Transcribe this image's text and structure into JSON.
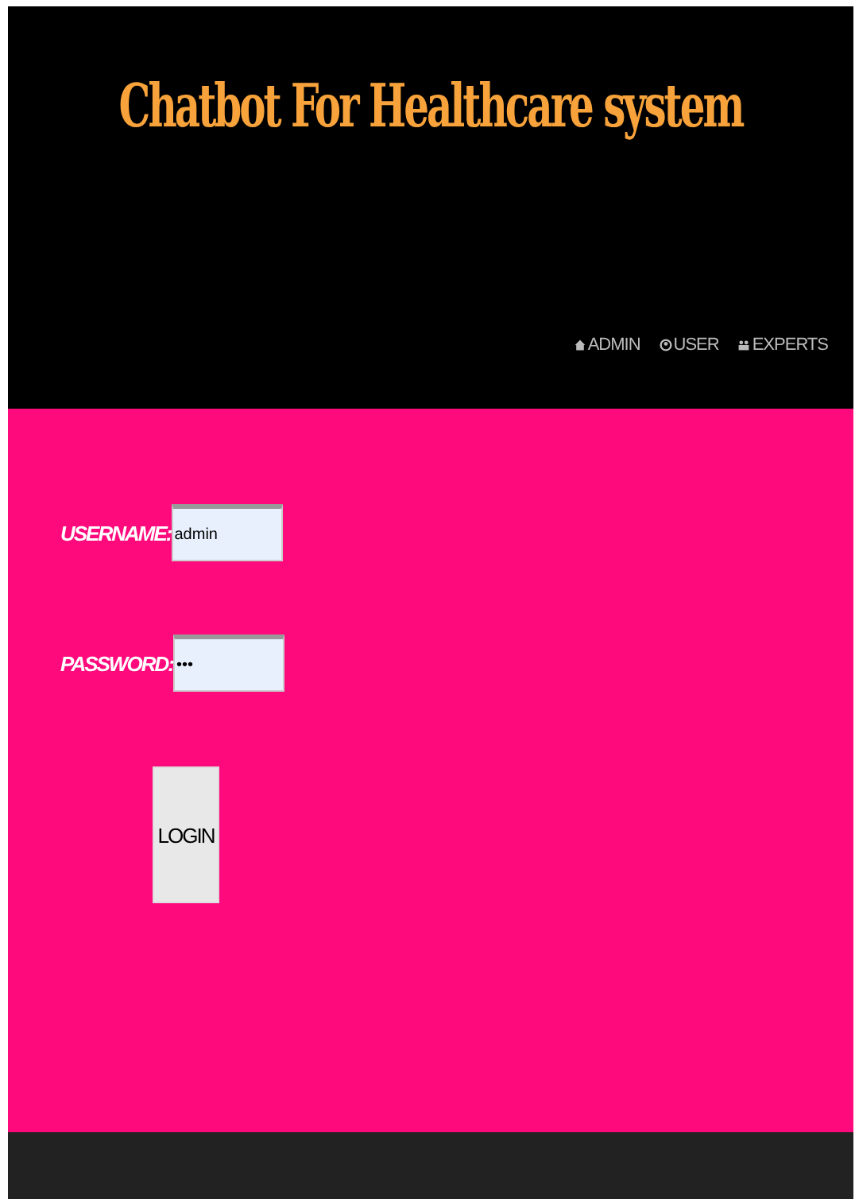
{
  "header": {
    "title": "Chatbot For Healthcare system"
  },
  "nav": [
    {
      "label": "ADMIN"
    },
    {
      "label": "USER"
    },
    {
      "label": "EXPERTS"
    }
  ],
  "form": {
    "fields": [
      {
        "label": "USERNAME:",
        "value": "admin"
      },
      {
        "label": "PASSWORD:",
        "value": "•••"
      }
    ],
    "button": "LOGIN"
  }
}
